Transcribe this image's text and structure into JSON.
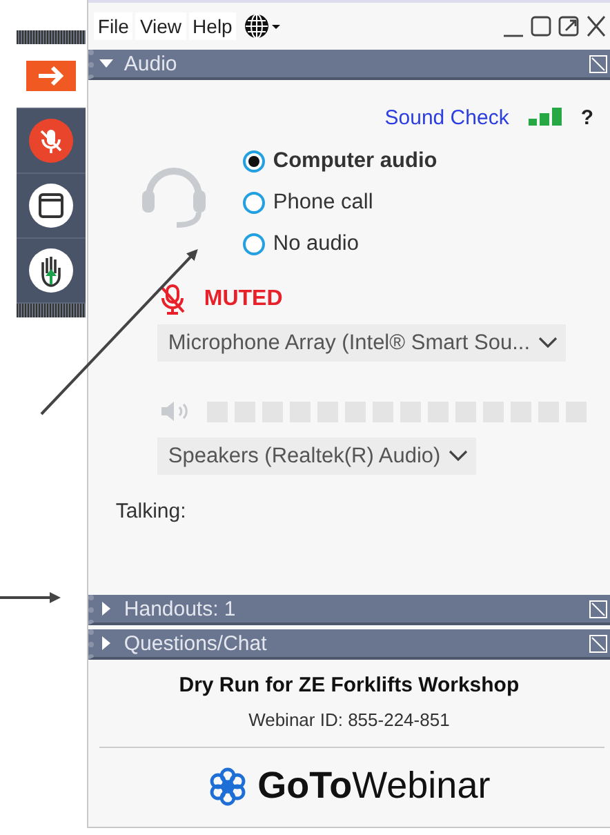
{
  "menu": [
    {
      "label": "File"
    },
    {
      "label": "View"
    },
    {
      "label": "Help"
    }
  ],
  "panels": [
    {
      "title": "Audio",
      "expanded": true
    },
    {
      "title": "Handouts: 1",
      "expanded": false
    },
    {
      "title": "Questions/Chat",
      "expanded": false
    }
  ],
  "audio": {
    "sound_check": "Sound Check",
    "help": "?",
    "options": [
      {
        "label": "Computer audio",
        "selected": true
      },
      {
        "label": "Phone call",
        "selected": false
      },
      {
        "label": "No audio",
        "selected": false
      }
    ],
    "mic_status": "MUTED",
    "muted": true,
    "microphone": "Microphone Array (Intel® Smart Sou...",
    "speaker_meter": {
      "level": 0
    },
    "speakers": "Speakers (Realtek(R) Audio)",
    "talking": "Talking:"
  },
  "footer": {
    "title": "Dry Run for ZE Forklifts Workshop",
    "webinar_id": "Webinar ID: 855-224-851",
    "logo": "**GoTo**Webinar"
  }
}
